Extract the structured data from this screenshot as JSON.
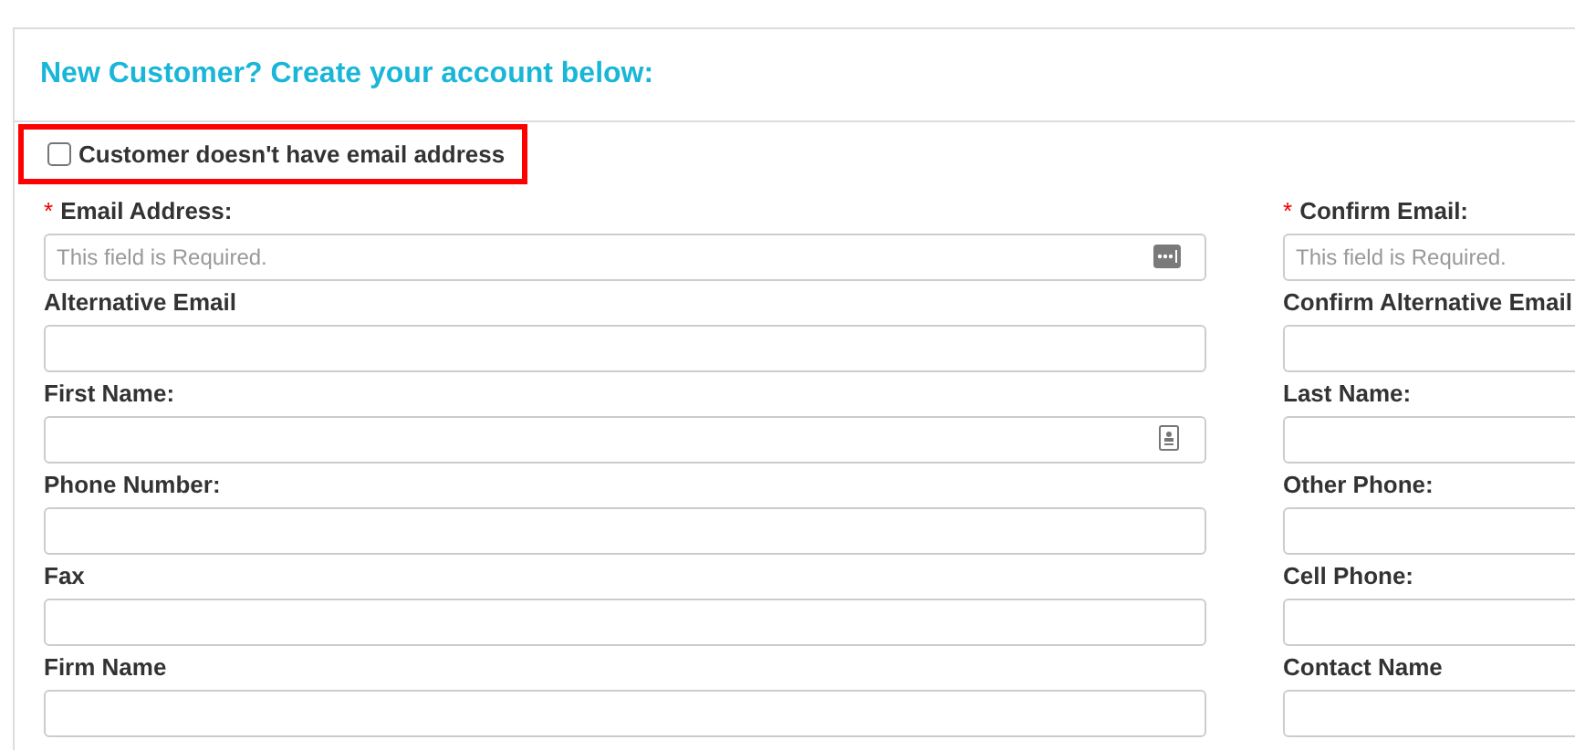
{
  "heading": "New Customer? Create your account below:",
  "no_email_option": {
    "label": "Customer doesn't have email address",
    "checked": false,
    "highlighted": true
  },
  "rows": [
    {
      "left": {
        "kind": "password",
        "label": "Email Address:",
        "required_mark": "*",
        "placeholder": "This field is Required."
      },
      "right": {
        "kind": "text",
        "label": "Confirm Email:",
        "required_mark": "*",
        "placeholder": "This field is Required."
      }
    },
    {
      "left": {
        "kind": "text",
        "label": "Alternative Email"
      },
      "right": {
        "kind": "text",
        "label": "Confirm Alternative Email"
      }
    },
    {
      "left": {
        "kind": "contact",
        "label": "First Name:"
      },
      "right": {
        "kind": "text",
        "label": "Last Name:"
      }
    },
    {
      "left": {
        "kind": "text",
        "label": "Phone Number:"
      },
      "right": {
        "kind": "text",
        "label": "Other Phone:"
      }
    },
    {
      "left": {
        "kind": "text",
        "label": "Fax"
      },
      "right": {
        "kind": "text",
        "label": "Cell Phone:"
      }
    },
    {
      "left": {
        "kind": "text",
        "label": "Firm Name"
      },
      "right": {
        "kind": "text",
        "label": "Contact Name"
      }
    }
  ]
}
